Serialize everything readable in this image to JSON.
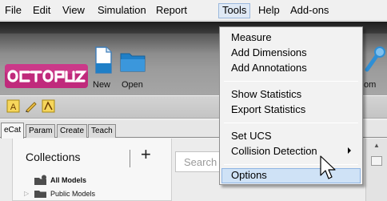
{
  "menubar": {
    "items": [
      {
        "label": "File"
      },
      {
        "label": "Edit"
      },
      {
        "label": "View"
      },
      {
        "label": "Simulation"
      },
      {
        "label": "Report"
      },
      {
        "label": "Tools"
      },
      {
        "label": "Help"
      },
      {
        "label": "Add-ons"
      }
    ]
  },
  "toolbar": {
    "new_label": "New",
    "open_label": "Open",
    "partial_label": "om"
  },
  "tabs": [
    "eCat",
    "Param",
    "Create",
    "Teach"
  ],
  "collections": {
    "title": "Collections",
    "add_symbol": "+",
    "tree": [
      {
        "label": "All Models"
      },
      {
        "label": "Public Models"
      }
    ]
  },
  "search": {
    "placeholder": "Search"
  },
  "tools_menu": {
    "items": [
      {
        "label": "Measure"
      },
      {
        "label": "Add Dimensions"
      },
      {
        "label": "Add Annotations"
      },
      {
        "label": "Show Statistics"
      },
      {
        "label": "Export Statistics"
      },
      {
        "label": "Set UCS"
      },
      {
        "label": "Collision Detection"
      },
      {
        "label": "Options"
      }
    ],
    "hover_color": "#cfe2f6"
  },
  "colors": {
    "logo_fill": "#c21f78",
    "folder_blue": "#1f7fc7"
  }
}
